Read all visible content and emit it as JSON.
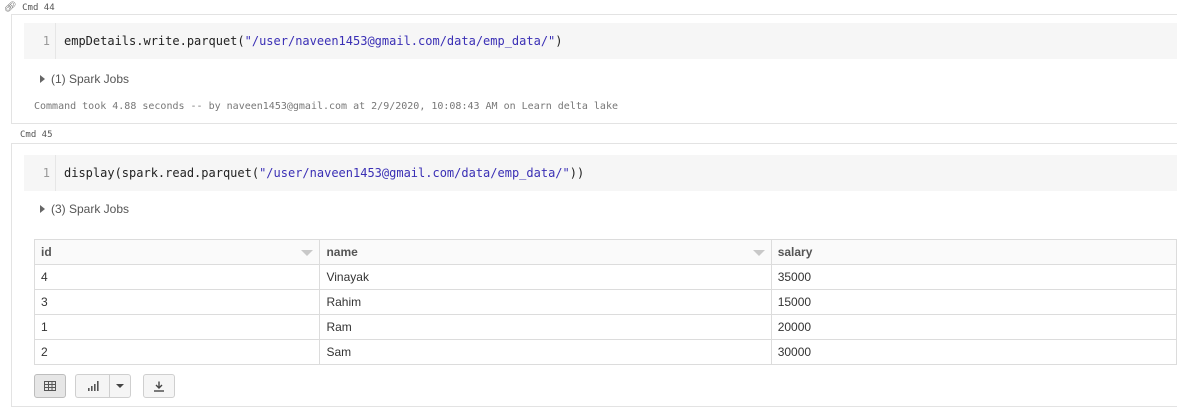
{
  "cells": [
    {
      "label": "Cmd 44",
      "line_number": "1",
      "code_prefix": "empDetails.write.parquet(",
      "code_string": "\"/user/naveen1453@gmail.com/data/emp_data/\"",
      "code_suffix": ")",
      "jobs_label": "(1) Spark Jobs",
      "command_took": "Command took 4.88 seconds -- by naveen1453@gmail.com at 2/9/2020, 10:08:43 AM on Learn delta lake"
    },
    {
      "label": "Cmd 45",
      "line_number": "1",
      "code_prefix": "display(spark.read.parquet(",
      "code_string": "\"/user/naveen1453@gmail.com/data/emp_data/\"",
      "code_suffix": "))",
      "jobs_label": "(3) Spark Jobs"
    }
  ],
  "result_table": {
    "columns": [
      "id",
      "name",
      "salary"
    ],
    "rows": [
      [
        "4",
        "Vinayak",
        "35000"
      ],
      [
        "3",
        "Rahim",
        "15000"
      ],
      [
        "1",
        "Ram",
        "20000"
      ],
      [
        "2",
        "Sam",
        "30000"
      ]
    ]
  },
  "icons": {
    "link": "link-icon",
    "table_view": "table-icon",
    "chart_view": "bar-chart-icon",
    "dropdown": "caret-down-icon",
    "download": "download-icon"
  }
}
